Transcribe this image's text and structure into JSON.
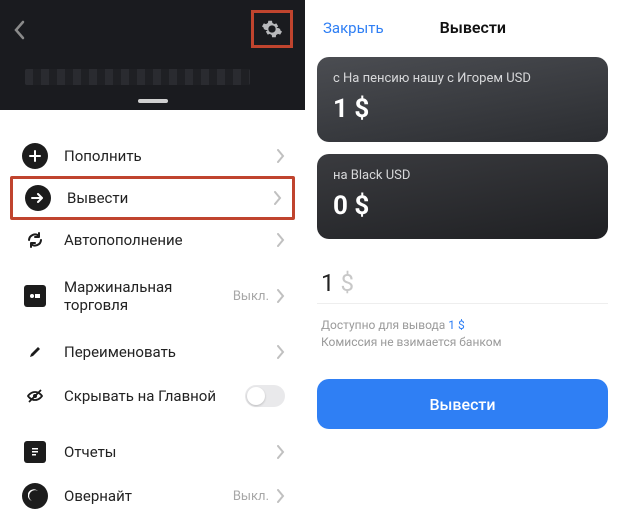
{
  "left": {
    "menu": {
      "topup": {
        "label": "Пополнить"
      },
      "withdraw": {
        "label": "Вывести"
      },
      "autotopup": {
        "label": "Автопополнение"
      },
      "margin": {
        "label": "Маржинальная торговля",
        "meta": "Выкл."
      },
      "rename": {
        "label": "Переименовать"
      },
      "hide": {
        "label": "Скрывать на Главной"
      },
      "reports": {
        "label": "Отчеты"
      },
      "overnight": {
        "label": "Овернайт",
        "meta": "Выкл."
      }
    }
  },
  "right": {
    "close": "Закрыть",
    "title": "Вывести",
    "card1": {
      "caption": "с На пенсию нашу с Игорем USD",
      "amount": "1 $"
    },
    "card2": {
      "caption": "на Black USD",
      "amount": "0 $"
    },
    "amount_value": "1",
    "amount_currency": "$",
    "available_prefix": "Доступно для вывода ",
    "available_link": "1 $",
    "fee_note": "Комиссия не взимается банком",
    "button": "Вывести"
  }
}
